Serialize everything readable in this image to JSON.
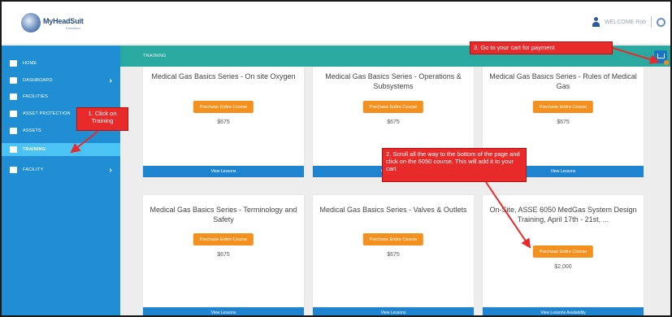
{
  "header": {
    "logo_text": "MyHeadSuit",
    "logo_sub": "Education",
    "user_name": "WELCOME Rob",
    "separator": "|"
  },
  "sidebar": {
    "items": [
      {
        "label": "HOME",
        "icon": "home-icon",
        "has_chevron": false
      },
      {
        "label": "DASHBOARD",
        "icon": "dashboard-icon",
        "has_chevron": true
      },
      {
        "label": "FACILITIES",
        "icon": "facilities-icon",
        "has_chevron": false
      },
      {
        "label": "ASSET PROTECTION",
        "icon": "asset-protection-icon",
        "has_chevron": false
      },
      {
        "label": "ASSETS",
        "icon": "assets-icon",
        "has_chevron": false
      },
      {
        "label": "TRAINING",
        "icon": "training-icon",
        "has_chevron": false,
        "active": true
      },
      {
        "label": "FACILITY",
        "icon": "facility-icon",
        "has_chevron": true
      }
    ]
  },
  "page": {
    "section_title": "TRAINING",
    "cart_icon": "cart-icon"
  },
  "cards": [
    {
      "title": "Medical Gas Basics Series - On site Oxygen",
      "button": "Purchase Entire Course",
      "price": "$675",
      "footer": "View Lessons"
    },
    {
      "title": "Medical Gas Basics Series - Operations & Subsystems",
      "button": "Purchase Entire Course",
      "price": "$675",
      "footer": "View Lessons"
    },
    {
      "title": "Medical Gas Basics Series - Rules of Medical Gas",
      "button": "Purchase Entire Course",
      "price": "$675",
      "footer": "View Lessons"
    },
    {
      "title": "Medical Gas Basics Series - Terminology and Safety",
      "button": "Purchase Entire Course",
      "price": "$675",
      "footer": "View Lessons"
    },
    {
      "title": "Medical Gas Basics Series - Valves & Outlets",
      "button": "Purchase Entire Course",
      "price": "$675",
      "footer": "View Lessons"
    },
    {
      "title": "On-Site, ASSE 6050 MedGas System Design Training, April 17th - 21st, ...",
      "button": "Purchase Entire Course",
      "price": "$2,000",
      "footer": "View Lessons Availability"
    }
  ],
  "callouts": {
    "step1": "1. Click on Training",
    "step2": "2. Scroll all the way to the bottom of the page and click on the 6050 course. This will add it to your cart",
    "step3": "3. Go to your cart for payment"
  },
  "colors": {
    "sidebar": "#1f8ed2",
    "sidebar_active": "#4cc3f5",
    "teal_header": "#2aa9a1",
    "button_orange": "#f4911e",
    "card_footer": "#1f84cf",
    "callout_red": "#e82a2a"
  }
}
